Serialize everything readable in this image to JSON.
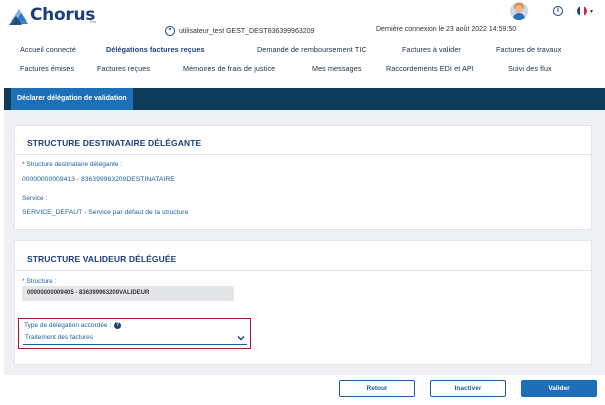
{
  "header": {
    "brand": "Chorus",
    "brand_sub": "Pro",
    "user": "utilisateur_test GEST_DEST836399963209",
    "last_connection": "Dernière connexion le 23 août 2022 14:59:50",
    "info_glyph": "i",
    "lang_caret": "▾"
  },
  "nav": {
    "row1": [
      "Accueil connecté",
      "Délégations factures reçues",
      "Demande de remboursement TIC",
      "Factures à valider",
      "Factures de travaux"
    ],
    "row2": [
      "Factures émises",
      "Factures reçues",
      "Mémoires de frais de justice",
      "Mes messages",
      "Raccordements EDI et API",
      "Suivi des flux"
    ]
  },
  "tab": {
    "active_label": "Déclarer délégation de validation"
  },
  "section1": {
    "title": "STRUCTURE DESTINATAIRE DÉLÉGANTE",
    "structure_label": "Structure destinataire délégante :",
    "structure_value": "00000000009413 - 836399963209DESTINATAIRE",
    "service_label": "Service :",
    "service_value": "SERVICE_DEFAUT - Service par défaut de la structure"
  },
  "section2": {
    "title": "STRUCTURE VALIDEUR DÉLÉGUÉE",
    "structure_label": "Structure :",
    "structure_value": "00000000009405 - 836399963209VALIDEUR",
    "delegation_label": "Type de délégation accordée :",
    "delegation_help": "?",
    "delegation_value": "Traitement des factures",
    "required_mark": "*"
  },
  "buttons": {
    "back": "Retour",
    "deactivate": "Inactiver",
    "validate": "Valider"
  },
  "colors": {
    "brand": "#1b3f7a",
    "tabbar": "#0e3b5a",
    "tab_active": "#1d6fb8",
    "highlight": "#a8172b"
  }
}
